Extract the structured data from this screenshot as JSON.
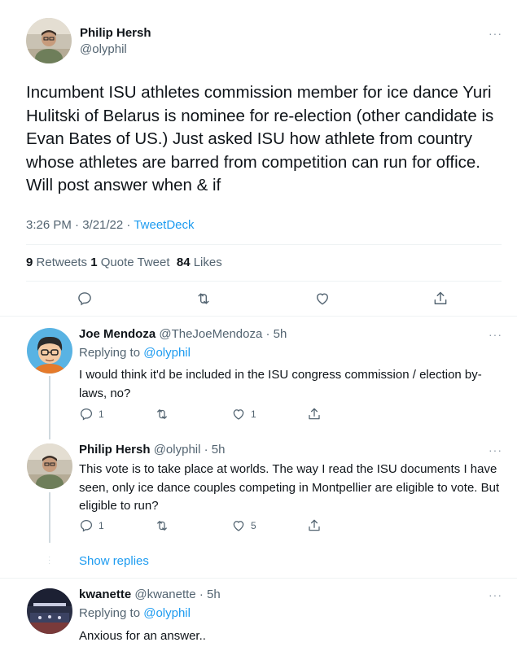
{
  "main_tweet": {
    "author_name": "Philip Hersh",
    "author_handle": "@olyphil",
    "more_label": "···",
    "text": "Incumbent ISU athletes commission member for ice dance Yuri Hulitski of Belarus is nominee for re-election (other candidate is Evan Bates of US.)  Just asked ISU how athlete from country whose athletes are barred from competition can run for office.  Will post answer when & if",
    "time_date": "3:26 PM · 3/21/22 ·",
    "source": "TweetDeck",
    "stats": {
      "retweets_count": "9",
      "retweets_label": "Retweets",
      "quotes_count": "1",
      "quotes_label": "Quote Tweet",
      "likes_count": "84",
      "likes_label": "Likes"
    }
  },
  "replies": [
    {
      "author_name": "Joe Mendoza",
      "author_handle": "@TheJoeMendoza",
      "time": "· 5h",
      "replying_prefix": "Replying to",
      "replying_to": "@olyphil",
      "text": "I would think it'd be included in the ISU congress commission / election by-laws, no?",
      "reply_count": "1",
      "retweet_count": "",
      "like_count": "1"
    },
    {
      "author_name": "Philip Hersh",
      "author_handle": "@olyphil",
      "time": "· 5h",
      "text": "This vote is to take place at worlds.  The way I read the ISU documents I have seen, only ice dance couples competing in Montpellier are eligible to vote.  But eligible to run?",
      "reply_count": "1",
      "retweet_count": "",
      "like_count": "5"
    },
    {
      "author_name": "kwanette",
      "author_handle": "@kwanette",
      "time": "· 5h",
      "replying_prefix": "Replying to",
      "replying_to": "@olyphil",
      "text": "Anxious for an answer.."
    }
  ],
  "show_replies_label": "Show replies",
  "icons": {
    "reply": "reply-icon",
    "retweet": "retweet-icon",
    "like": "heart-icon",
    "share": "share-icon",
    "more": "more-icon"
  },
  "colors": {
    "link": "#1d9bf0",
    "secondary_text": "#536471",
    "divider": "#eff3f4"
  }
}
